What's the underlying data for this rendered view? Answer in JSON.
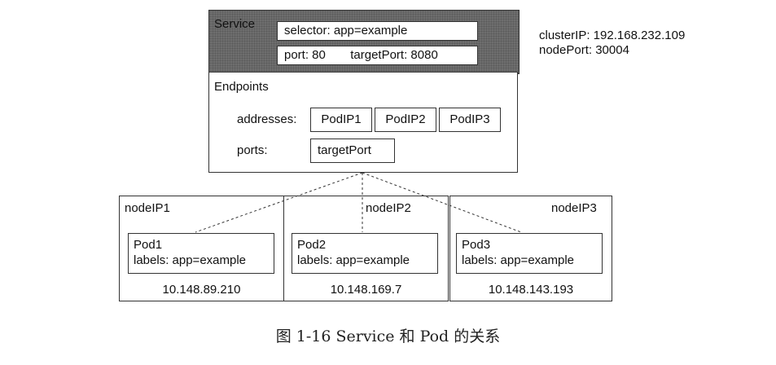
{
  "service": {
    "title": "Service",
    "selector": "selector:  app=example",
    "port": "port: 80",
    "target_port": "targetPort: 8080"
  },
  "cluster_info": {
    "cluster_ip": "clusterIP: 192.168.232.109",
    "node_port": "nodePort: 30004"
  },
  "endpoints": {
    "title": "Endpoints",
    "addresses_label": "addresses:",
    "addresses": [
      "PodIP1",
      "PodIP2",
      "PodIP3"
    ],
    "ports_label": "ports:",
    "ports_value": "targetPort"
  },
  "nodes": [
    {
      "label": "nodeIP1",
      "pod_name": "Pod1",
      "pod_labels": "labels: app=example",
      "ip": "10.148.89.210"
    },
    {
      "label": "nodeIP2",
      "pod_name": "Pod2",
      "pod_labels": "labels: app=example",
      "ip": "10.148.169.7"
    },
    {
      "label": "nodeIP3",
      "pod_name": "Pod3",
      "pod_labels": "labels: app=example",
      "ip": "10.148.143.193"
    }
  ],
  "caption": "图 1-16   Service 和 Pod 的关系"
}
